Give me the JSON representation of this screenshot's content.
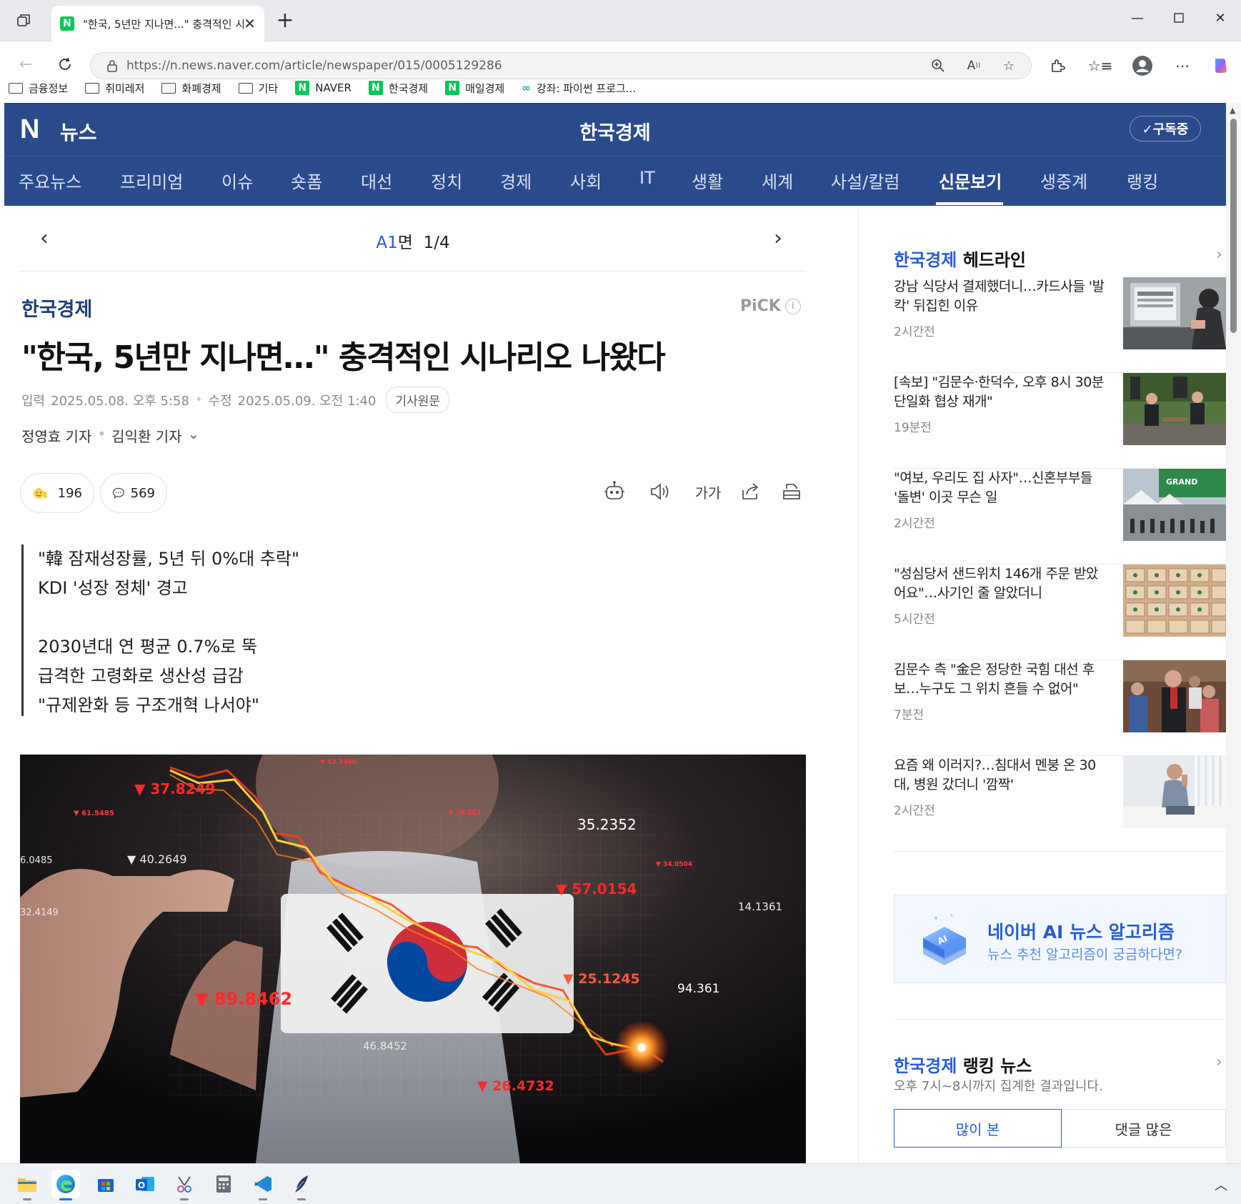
{
  "browser": {
    "tab_title": "\"한국, 5년만 지나면...\" 충격적인 시나리오",
    "url": "https://n.news.naver.com/article/newspaper/015/0005129286",
    "bookmarks": [
      {
        "label": "금융정보",
        "type": "folder"
      },
      {
        "label": "취미레저",
        "type": "folder"
      },
      {
        "label": "화폐경제",
        "type": "folder"
      },
      {
        "label": "기타",
        "type": "folder"
      },
      {
        "label": "NAVER",
        "type": "naver"
      },
      {
        "label": "한국경제",
        "type": "naver"
      },
      {
        "label": "매일경제",
        "type": "naver"
      },
      {
        "label": "강좌: 파이썬 프로그...",
        "type": "link"
      }
    ]
  },
  "header": {
    "logo": "N",
    "service": "뉴스",
    "press": "한국경제",
    "subscribe_label": "✓구독중"
  },
  "categories": [
    "주요뉴스",
    "프리미엄",
    "이슈",
    "숏폼",
    "대선",
    "정치",
    "경제",
    "사회",
    "IT",
    "생활",
    "세계",
    "사설/칼럼",
    "신문보기",
    "생중계",
    "랭킹"
  ],
  "active_category": "신문보기",
  "pagenav": {
    "section": "A1",
    "section_suffix": "면",
    "page": "1/4"
  },
  "article": {
    "press": "한국경제",
    "pick": "PiCK",
    "headline": "\"한국, 5년만 지나면…\" 충격적인 시나리오 나왔다",
    "input_label": "입력",
    "input_date": "2025.05.08. 오후 5:58",
    "edit_label": "수정",
    "edit_date": "2025.05.09. 오전 1:40",
    "original_label": "기사원문",
    "reporter1": "정영효 기자",
    "reporter2": "김익환 기자",
    "reaction_count": "196",
    "comment_count": "569",
    "font_size_label": "가가",
    "summary": [
      "\"韓 잠재성장률, 5년 뒤 0%대 추락\"",
      "KDI '성장 정체' 경고",
      "2030년대 연 평균 0.7%로 뚝",
      "급격한 고령화로 생산성 급감",
      "\"규제완화 등 구조개혁 나서야\""
    ],
    "image_numbers": [
      "37.8249",
      "40.2649",
      "35.2352",
      "57.0154",
      "14.1361",
      "89.8462",
      "25.1245",
      "94.361",
      "46.8452",
      "26.4732",
      "61.5485",
      "6.0485",
      "32.4149",
      "52.7460",
      "34.0504",
      "79.283"
    ]
  },
  "sidebar": {
    "headline_press": "한국경제",
    "headline_suffix": "헤드라인",
    "more": "›",
    "items": [
      {
        "title": "강남 식당서 결제했더니…카드사들 '발칵' 뒤집힌 이유",
        "time": "2시간전"
      },
      {
        "title": "[속보] \"김문수·한덕수, 오후 8시 30분 단일화 협상 재개\"",
        "time": "19분전"
      },
      {
        "title": "\"여보, 우리도 집 사자\"…신혼부부들 '돌변' 이곳 무슨 일",
        "time": "2시간전"
      },
      {
        "title": "\"성심당서 샌드위치 146개 주문 받았어요\"…사기인 줄 알았더니",
        "time": "5시간전"
      },
      {
        "title": "김문수 측 \"金은 정당한 국힘 대선 후보…누구도 그 위치 흔들 수 없어\"",
        "time": "7분전"
      },
      {
        "title": "요즘 왜 이러지?…침대서 멘붕 온 30대, 병원 갔더니 '깜짝'",
        "time": "2시간전"
      }
    ],
    "ai_title": "네이버 AI 뉴스 알고리즘",
    "ai_sub": "뉴스 추천 알고리즘이 궁금하다면?",
    "ranking_press": "한국경제",
    "ranking_suffix": "랭킹 뉴스",
    "ranking_sub": "오후 7시~8시까지 집계한 결과입니다.",
    "ranking_tabs": [
      "많이 본",
      "댓글 많은"
    ]
  },
  "colors": {
    "naver_blue": "#2a4b8b",
    "naver_green": "#03c75a",
    "link_blue": "#2a5bd7"
  }
}
